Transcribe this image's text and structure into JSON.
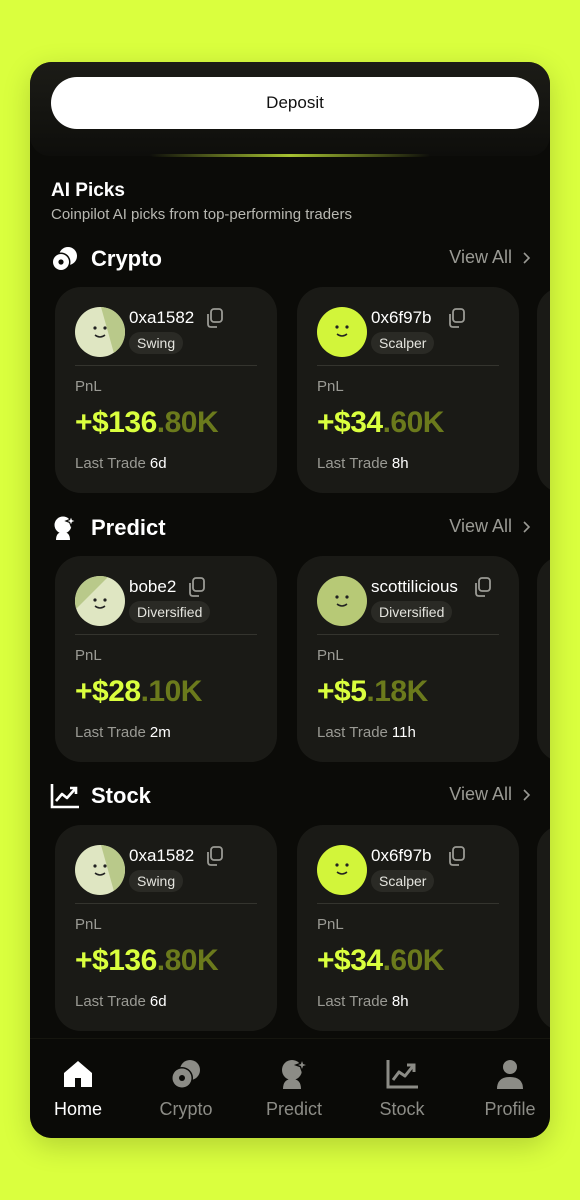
{
  "deposit": {
    "label": "Deposit"
  },
  "ai_picks": {
    "title": "AI Picks",
    "subtitle": "Coinpilot AI picks from top-performing traders"
  },
  "sections": [
    {
      "title": "Crypto",
      "view_all": "View All",
      "icon": "coins-icon",
      "cards": [
        {
          "handle": "0xa1582",
          "tag": "Swing",
          "pnl_label": "PnL",
          "pnl_main": "+$136",
          "pnl_dec": ".80K",
          "last_label": "Last Trade",
          "last_value": "6d",
          "avatar": "light"
        },
        {
          "handle": "0x6f97b",
          "tag": "Scalper",
          "pnl_label": "PnL",
          "pnl_main": "+$34",
          "pnl_dec": ".60K",
          "last_label": "Last Trade",
          "last_value": "8h",
          "avatar": "lime"
        }
      ]
    },
    {
      "title": "Predict",
      "view_all": "View All",
      "icon": "crystal-ball-icon",
      "cards": [
        {
          "handle": "bobe2",
          "tag": "Diversified",
          "pnl_label": "PnL",
          "pnl_main": "+$28",
          "pnl_dec": ".10K",
          "last_label": "Last Trade",
          "last_value": "2m",
          "avatar": "light"
        },
        {
          "handle": "scottilicious",
          "tag": "Diversified",
          "pnl_label": "PnL",
          "pnl_main": "+$5",
          "pnl_dec": ".18K",
          "last_label": "Last Trade",
          "last_value": "11h",
          "avatar": "olive"
        }
      ]
    },
    {
      "title": "Stock",
      "view_all": "View All",
      "icon": "chart-icon",
      "cards": [
        {
          "handle": "0xa1582",
          "tag": "Swing",
          "pnl_label": "PnL",
          "pnl_main": "+$136",
          "pnl_dec": ".80K",
          "last_label": "Last Trade",
          "last_value": "6d",
          "avatar": "light"
        },
        {
          "handle": "0x6f97b",
          "tag": "Scalper",
          "pnl_label": "PnL",
          "pnl_main": "+$34",
          "pnl_dec": ".60K",
          "last_label": "Last Trade",
          "last_value": "8h",
          "avatar": "lime"
        }
      ]
    }
  ],
  "nav": [
    {
      "label": "Home",
      "icon": "home-icon",
      "active": true
    },
    {
      "label": "Crypto",
      "icon": "coins-icon",
      "active": false
    },
    {
      "label": "Predict",
      "icon": "crystal-ball-icon",
      "active": false
    },
    {
      "label": "Stock",
      "icon": "chart-icon",
      "active": false
    },
    {
      "label": "Profile",
      "icon": "person-icon",
      "active": false
    }
  ],
  "colors": {
    "accent": "#daff3e",
    "background": "#0b0b08",
    "card": "#1a1a16",
    "pnl_dim": "#6b7a1c"
  }
}
